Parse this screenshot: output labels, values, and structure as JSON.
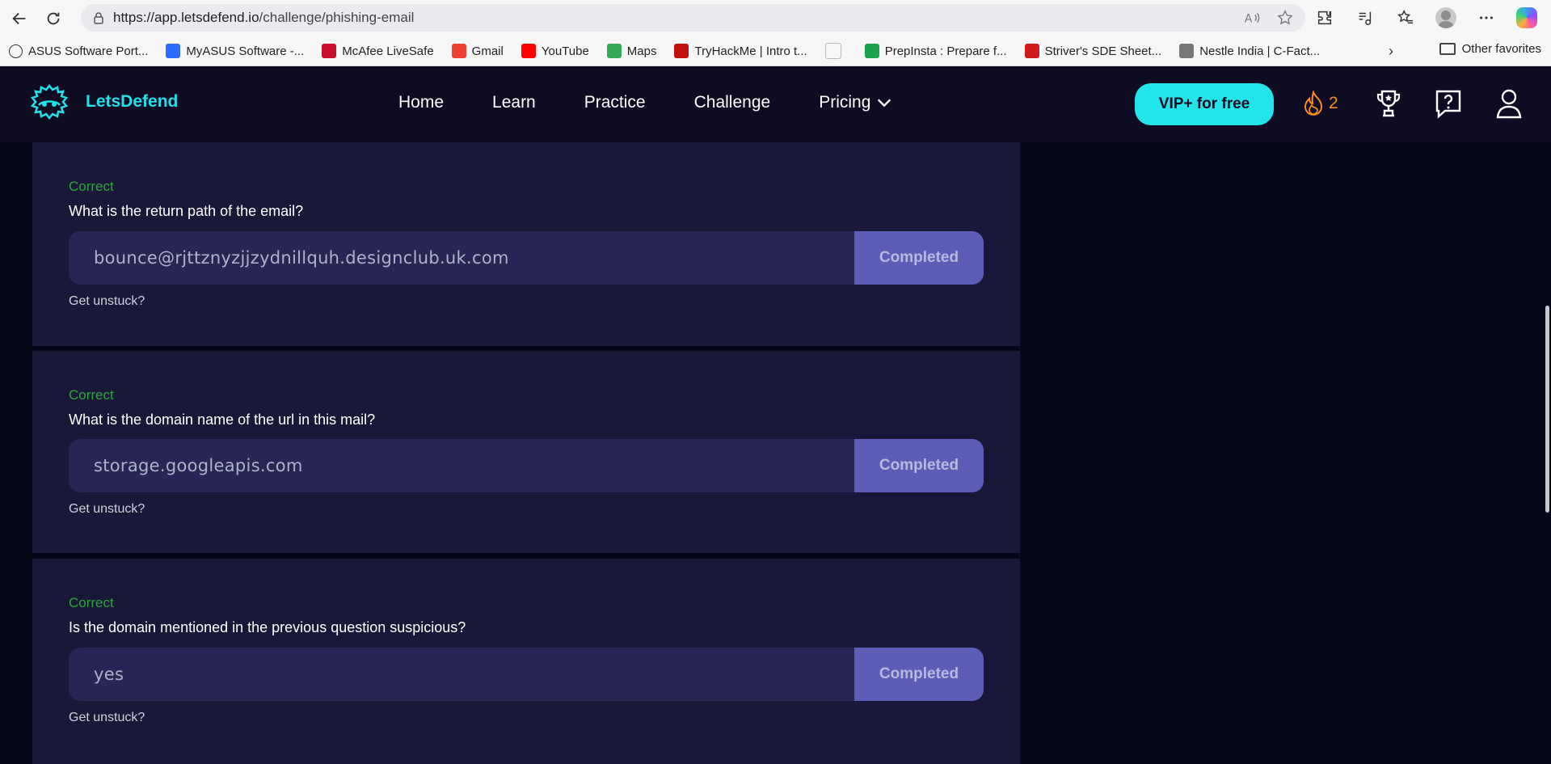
{
  "browser": {
    "url_host": "https://app.letsdefend.io",
    "url_path": "/challenge/phishing-email",
    "bookmarks": [
      {
        "label": "ASUS Software Port...",
        "icon": "globe-icon",
        "color": "#333333"
      },
      {
        "label": "MyASUS Software -...",
        "icon": "myasus-icon",
        "color": "#2b6cff"
      },
      {
        "label": "McAfee LiveSafe",
        "icon": "mcafee-icon",
        "color": "#c8102e"
      },
      {
        "label": "Gmail",
        "icon": "gmail-icon",
        "color": "#ea4335"
      },
      {
        "label": "YouTube",
        "icon": "youtube-icon",
        "color": "#ff0000"
      },
      {
        "label": "Maps",
        "icon": "maps-icon",
        "color": "#34a853"
      },
      {
        "label": "TryHackMe | Intro t...",
        "icon": "tryhackme-icon",
        "color": "#c11111"
      },
      {
        "label": "",
        "icon": "blank-page-icon",
        "color": "#bbbbbb"
      },
      {
        "label": "PrepInsta : Prepare f...",
        "icon": "prepinsta-icon",
        "color": "#1aa34a"
      },
      {
        "label": "Striver's SDE Sheet...",
        "icon": "tuf-icon",
        "color": "#d11a1a"
      },
      {
        "label": "Nestle India | C-Fact...",
        "icon": "nestle-icon",
        "color": "#777777"
      }
    ],
    "other_favorites": "Other favorites"
  },
  "app": {
    "logo_text": "LetsDefend",
    "nav": [
      {
        "label": "Home"
      },
      {
        "label": "Learn"
      },
      {
        "label": "Practice"
      },
      {
        "label": "Challenge"
      },
      {
        "label": "Pricing"
      }
    ],
    "vip_button": "VIP+ for free",
    "streak_count": "2",
    "accent_color": "#23e4e9"
  },
  "questions": [
    {
      "status": "Correct",
      "question": "What is the return path of the email?",
      "answer": "bounce@rjttznyzjjzydnillquh.designclub.uk.com",
      "button": "Completed",
      "help": "Get unstuck?"
    },
    {
      "status": "Correct",
      "question": "What is the domain name of the url in this mail?",
      "answer": "storage.googleapis.com",
      "button": "Completed",
      "help": "Get unstuck?"
    },
    {
      "status": "Correct",
      "question": "Is the domain mentioned in the previous question suspicious?",
      "answer": "yes",
      "button": "Completed",
      "help": "Get unstuck?"
    }
  ]
}
